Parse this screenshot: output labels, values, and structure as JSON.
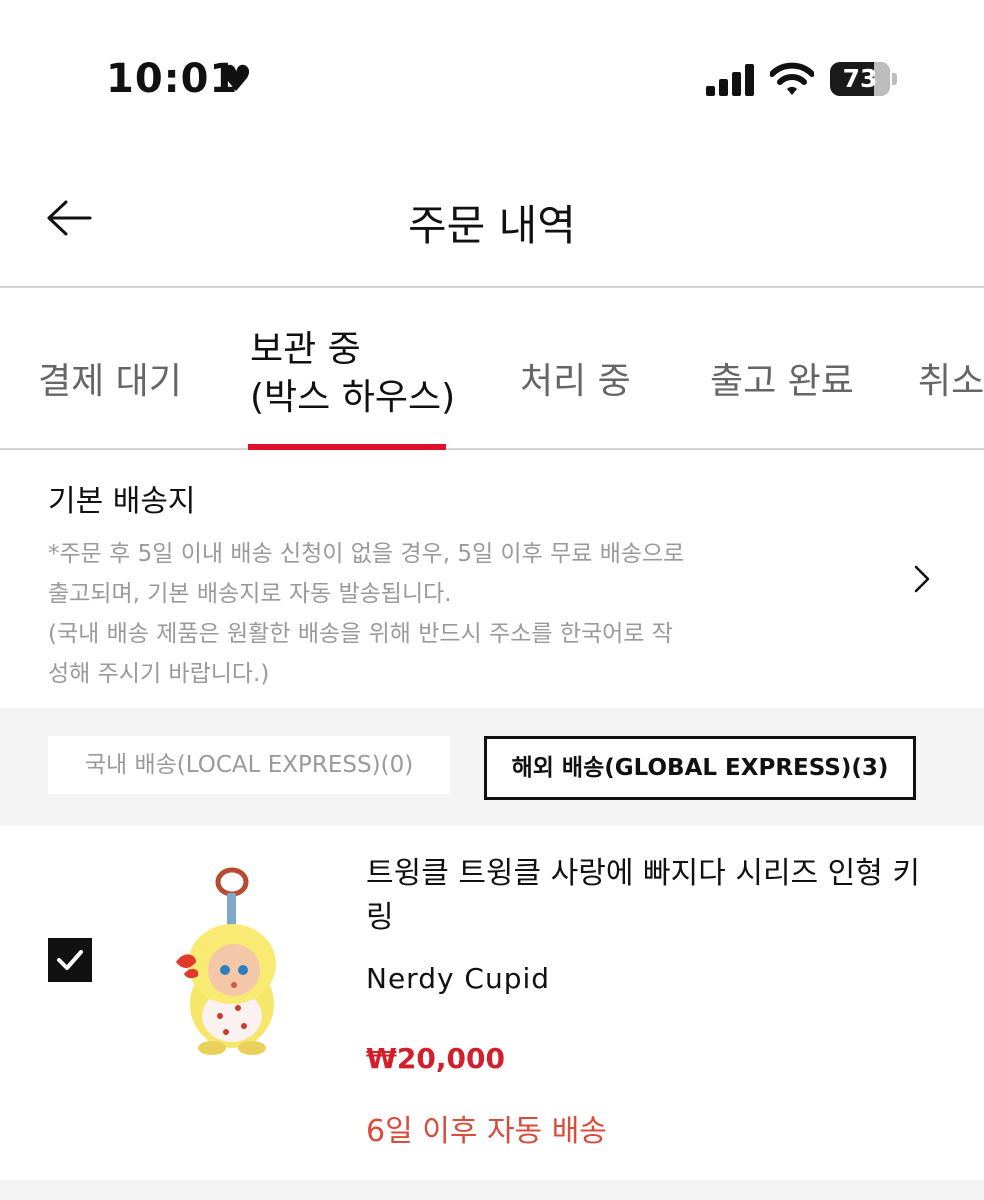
{
  "status_bar": {
    "time": "10:01",
    "battery_level": "73",
    "battery_fraction": 0.73,
    "icons": [
      "heart-icon",
      "signal-icon",
      "wifi-icon",
      "battery-icon"
    ]
  },
  "header": {
    "title": "주문 내역",
    "back_icon": "arrow-left-icon"
  },
  "tabs": [
    {
      "label": "결제 대기",
      "active": false
    },
    {
      "label_line1": "보관 중",
      "label_line2": "(박스 하우스)",
      "active": true
    },
    {
      "label": "처리 중",
      "active": false
    },
    {
      "label": "출고 완료",
      "active": false
    },
    {
      "label": "취소",
      "active": false
    }
  ],
  "address": {
    "title": "기본 배송지",
    "notice_lines": [
      "*주문 후 5일 이내 배송 신청이 없을 경우, 5일 이후 무료 배송으로",
      "출고되며, 기본 배송지로 자동 발송됩니다.",
      "(국내 배송 제품은 원활한 배송을 위해 반드시 주소를 한국어로 작",
      "성해 주시기 바랍니다.)"
    ]
  },
  "filters": {
    "local": "국내 배송(LOCAL EXPRESS)(0)",
    "global": "해외 배송(GLOBAL EXPRESS)(3)",
    "selected": "global"
  },
  "product": {
    "checked": true,
    "name": "트윙클 트윙클 사랑에 빠지다 시리즈 인형 키링",
    "brand": "Nerdy Cupid",
    "price": "₩20,000",
    "shipping_note": "6일 이후 자동 배송"
  },
  "colors": {
    "accent_red": "#e0102a",
    "price_red": "#d21f2b",
    "note_red": "#d94c3b",
    "gray_text": "#9a9a9a",
    "filter_bg": "#f4f4f4"
  }
}
